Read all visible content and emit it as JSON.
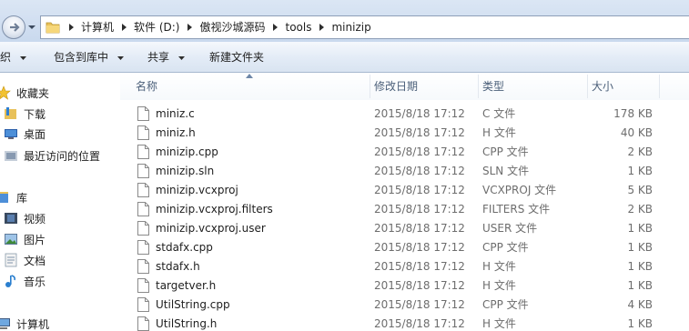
{
  "address": {
    "crumbs": [
      "计算机",
      "软件 (D:)",
      "傲视沙城源码",
      "tools",
      "minizip"
    ]
  },
  "toolbar": {
    "organize": "组织",
    "include_in_library": "包含到库中",
    "share": "共享",
    "new_folder": "新建文件夹"
  },
  "nav": {
    "favorites": "收藏夹",
    "downloads": "下载",
    "desktop": "桌面",
    "recent": "最近访问的位置",
    "libraries": "库",
    "videos": "视频",
    "pictures": "图片",
    "documents": "文档",
    "music": "音乐",
    "computer": "计算机"
  },
  "columns": {
    "name": "名称",
    "modified": "修改日期",
    "type": "类型",
    "size": "大小"
  },
  "files": [
    {
      "name": "miniz.c",
      "modified": "2015/8/18 17:12",
      "type": "C 文件",
      "size": "178 KB"
    },
    {
      "name": "miniz.h",
      "modified": "2015/8/18 17:12",
      "type": "H 文件",
      "size": "40 KB"
    },
    {
      "name": "minizip.cpp",
      "modified": "2015/8/18 17:12",
      "type": "CPP 文件",
      "size": "2 KB"
    },
    {
      "name": "minizip.sln",
      "modified": "2015/8/18 17:12",
      "type": "SLN 文件",
      "size": "1 KB"
    },
    {
      "name": "minizip.vcxproj",
      "modified": "2015/8/18 17:12",
      "type": "VCXPROJ 文件",
      "size": "5 KB"
    },
    {
      "name": "minizip.vcxproj.filters",
      "modified": "2015/8/18 17:12",
      "type": "FILTERS 文件",
      "size": "2 KB"
    },
    {
      "name": "minizip.vcxproj.user",
      "modified": "2015/8/18 17:12",
      "type": "USER 文件",
      "size": "1 KB"
    },
    {
      "name": "stdafx.cpp",
      "modified": "2015/8/18 17:12",
      "type": "CPP 文件",
      "size": "1 KB"
    },
    {
      "name": "stdafx.h",
      "modified": "2015/8/18 17:12",
      "type": "H 文件",
      "size": "1 KB"
    },
    {
      "name": "targetver.h",
      "modified": "2015/8/18 17:12",
      "type": "H 文件",
      "size": "1 KB"
    },
    {
      "name": "UtilString.cpp",
      "modified": "2015/8/18 17:12",
      "type": "CPP 文件",
      "size": "4 KB"
    },
    {
      "name": "UtilString.h",
      "modified": "2015/8/18 17:12",
      "type": "H 文件",
      "size": "1 KB"
    }
  ]
}
